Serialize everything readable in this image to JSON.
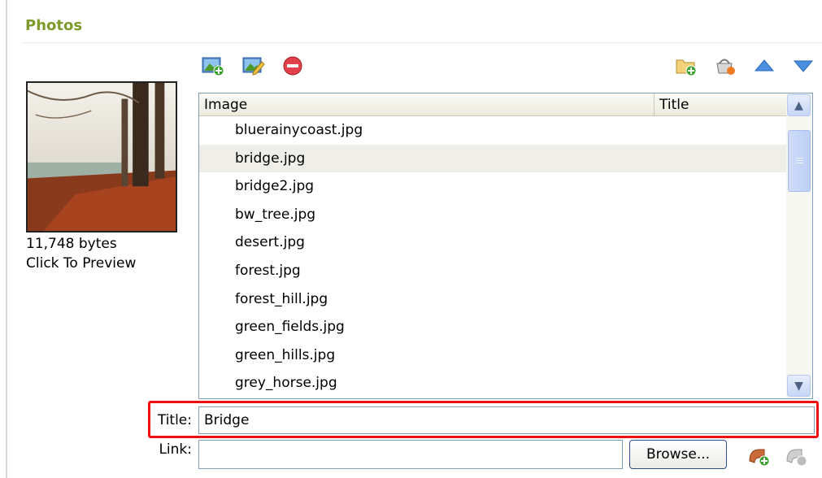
{
  "section": {
    "title": "Photos"
  },
  "toolbar": {
    "left_icons": [
      "add-image-icon",
      "edit-image-icon",
      "remove-icon"
    ],
    "right_icons": [
      "new-folder-icon",
      "basket-icon",
      "move-up-icon",
      "move-down-icon"
    ]
  },
  "preview": {
    "size": "11,748 bytes",
    "hint": "Click To Preview"
  },
  "list": {
    "columns": {
      "image": "Image",
      "title": "Title"
    },
    "rows": [
      "bluerainycoast.jpg",
      "bridge.jpg",
      "bridge2.jpg",
      "bw_tree.jpg",
      "desert.jpg",
      "forest.jpg",
      "forest_hill.jpg",
      "green_fields.jpg",
      "green_hills.jpg",
      "grey_horse.jpg"
    ],
    "selected_row": "bridge.jpg"
  },
  "form": {
    "title_label": "Title:",
    "title_value": "Bridge",
    "link_label": "Link:",
    "link_value": "",
    "browse_label": "Browse..."
  },
  "colors": {
    "section_title": "#7d9a2b",
    "highlight_border": "#ee1111",
    "selected_row_bg": "#f0eee8"
  }
}
